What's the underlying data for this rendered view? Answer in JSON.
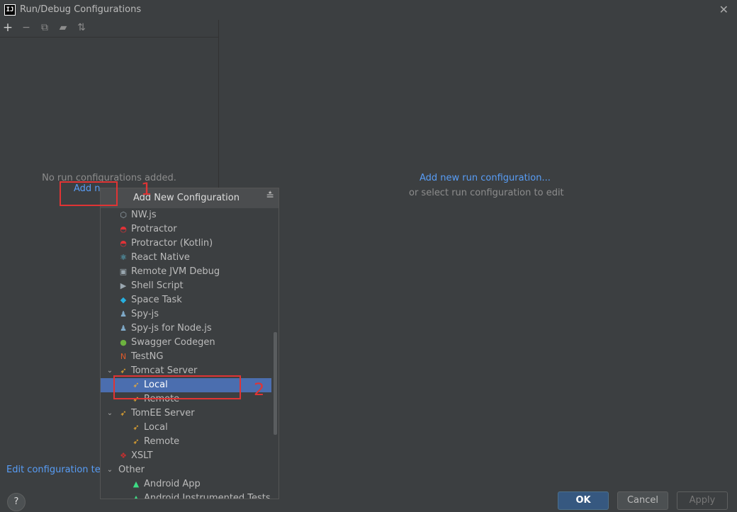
{
  "window": {
    "title": "Run/Debug Configurations",
    "icon_text": "IJ"
  },
  "toolbar": {
    "icons": [
      "plus-icon",
      "minus-icon",
      "copy-icon",
      "folder-icon",
      "sort-icon"
    ]
  },
  "left": {
    "empty_message": "No run configurations added.",
    "add_link": "Add n",
    "edit_templates": "Edit configuration temp"
  },
  "right": {
    "add_link": "Add new run configuration...",
    "hint": "or select run configuration to edit"
  },
  "popup": {
    "title": "Add New Configuration",
    "items": [
      {
        "label": "NW.js",
        "icon": "nwjs-icon",
        "indent": 1
      },
      {
        "label": "Protractor",
        "icon": "protractor-icon",
        "indent": 1
      },
      {
        "label": "Protractor (Kotlin)",
        "icon": "protractor-icon",
        "indent": 1
      },
      {
        "label": "React Native",
        "icon": "react-icon",
        "indent": 1
      },
      {
        "label": "Remote JVM Debug",
        "icon": "remote-debug-icon",
        "indent": 1
      },
      {
        "label": "Shell Script",
        "icon": "shell-icon",
        "indent": 1
      },
      {
        "label": "Space Task",
        "icon": "space-icon",
        "indent": 1
      },
      {
        "label": "Spy-js",
        "icon": "spyjs-icon",
        "indent": 1
      },
      {
        "label": "Spy-js for Node.js",
        "icon": "spyjs-icon",
        "indent": 1
      },
      {
        "label": "Swagger Codegen",
        "icon": "swagger-icon",
        "indent": 1
      },
      {
        "label": "TestNG",
        "icon": "testng-icon",
        "indent": 1
      },
      {
        "label": "Tomcat Server",
        "icon": "tomcat-icon",
        "indent": 1,
        "expanded": true
      },
      {
        "label": "Local",
        "icon": "tomcat-icon",
        "indent": 2,
        "selected": true
      },
      {
        "label": "Remote",
        "icon": "tomcat-icon",
        "indent": 2
      },
      {
        "label": "TomEE Server",
        "icon": "tomcat-icon",
        "indent": 1,
        "expanded": true
      },
      {
        "label": "Local",
        "icon": "tomcat-icon",
        "indent": 2
      },
      {
        "label": "Remote",
        "icon": "tomcat-icon",
        "indent": 2
      },
      {
        "label": "XSLT",
        "icon": "xslt-icon",
        "indent": 1
      },
      {
        "label": "Other",
        "icon": "",
        "indent": 0,
        "expanded": true
      },
      {
        "label": "Android App",
        "icon": "android-icon",
        "indent": 2
      },
      {
        "label": "Android Instrumented Tests",
        "icon": "android-icon",
        "indent": 2
      }
    ]
  },
  "buttons": {
    "help": "?",
    "ok": "OK",
    "cancel": "Cancel",
    "apply": "Apply"
  },
  "annotations": {
    "one": "1",
    "two": "2"
  },
  "colors": {
    "accent": "#589df6",
    "selection": "#4b6eaf",
    "annotation": "#e03434"
  }
}
